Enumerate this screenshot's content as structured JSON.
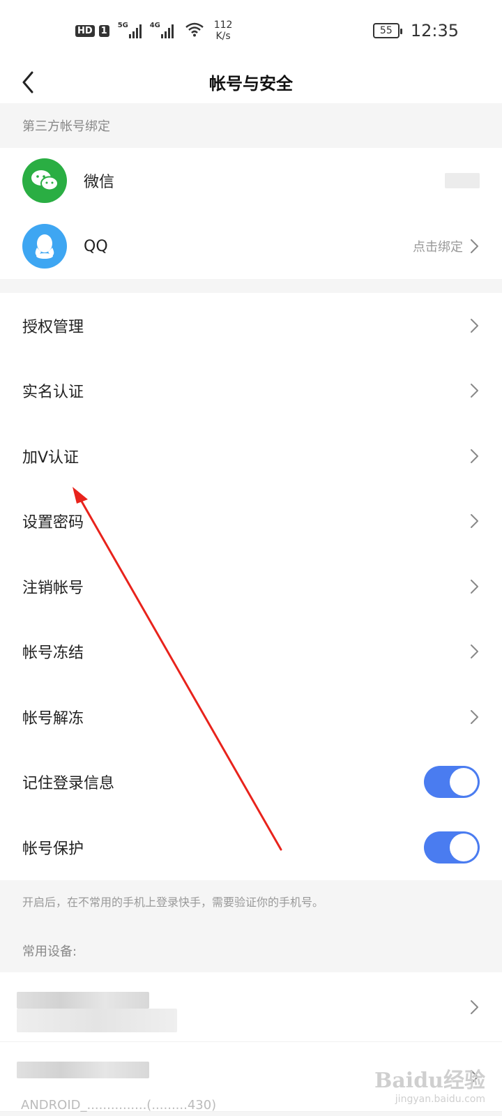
{
  "status_bar": {
    "hd": "HD",
    "sim": "1",
    "signal_1": "5G",
    "signal_2": "4G",
    "speed_value": "112",
    "speed_unit": "K/s",
    "battery": "55",
    "time": "12:35"
  },
  "header": {
    "title": "帐号与安全",
    "back_icon": "chevron-left-icon"
  },
  "third_party": {
    "section_title": "第三方帐号绑定",
    "items": [
      {
        "label": "微信",
        "icon": "wechat-icon",
        "color": "#2aae43",
        "status": ""
      },
      {
        "label": "QQ",
        "icon": "qq-icon",
        "color": "#3ea6f2",
        "status": "点击绑定"
      }
    ]
  },
  "menu": {
    "items": [
      {
        "label": "授权管理"
      },
      {
        "label": "实名认证"
      },
      {
        "label": "加V认证"
      },
      {
        "label": "设置密码"
      },
      {
        "label": "注销帐号"
      },
      {
        "label": "帐号冻结"
      },
      {
        "label": "帐号解冻"
      }
    ]
  },
  "toggles": {
    "accent": "#4a7cf0",
    "items": [
      {
        "label": "记住登录信息",
        "on": true
      },
      {
        "label": "帐号保护",
        "on": true
      }
    ],
    "note": "开启后，在不常用的手机上登录快手，需要验证你的手机号。"
  },
  "devices": {
    "section_title": "常用设备:",
    "second_device_sub": "ANDROID_...............(.........430)"
  },
  "watermark": {
    "logo": "Baidu经验",
    "sub": "jingyan.baidu.com"
  }
}
